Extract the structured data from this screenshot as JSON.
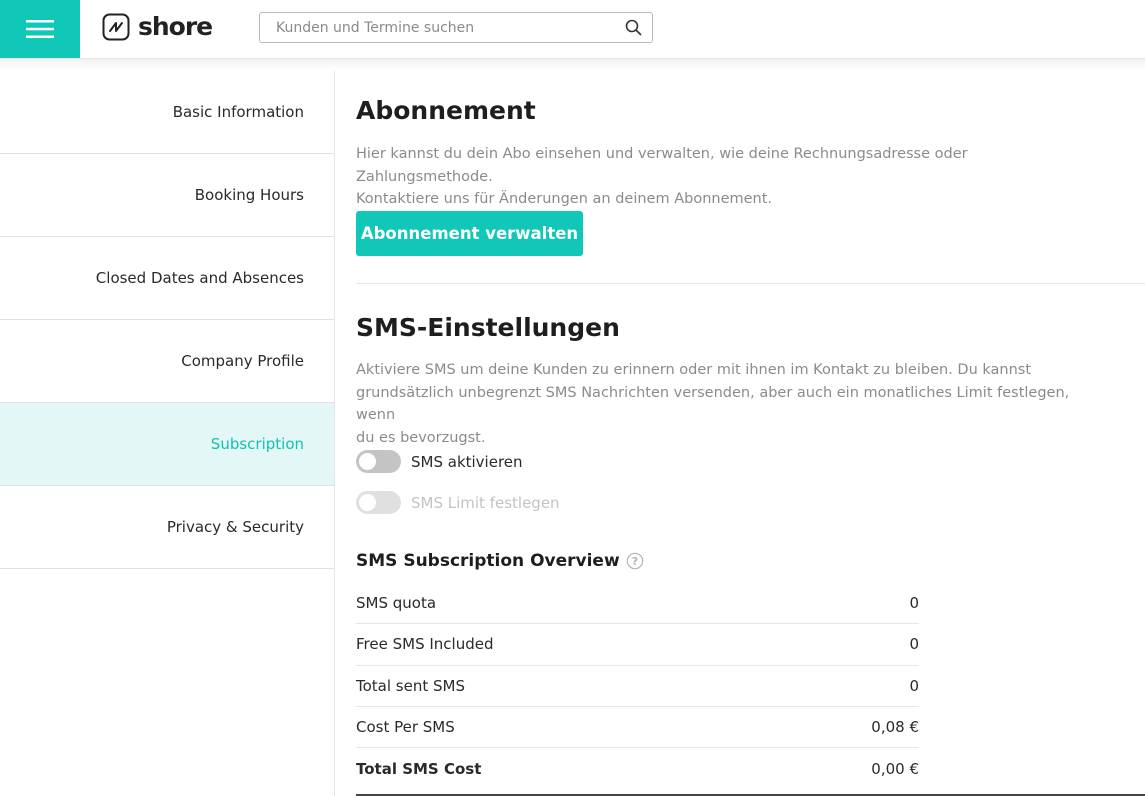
{
  "header": {
    "logo_text": "shore",
    "search_placeholder": "Kunden und Termine suchen"
  },
  "sidebar": {
    "items": [
      {
        "label": "Basic Information"
      },
      {
        "label": "Booking Hours"
      },
      {
        "label": "Closed Dates and Absences"
      },
      {
        "label": "Company Profile"
      },
      {
        "label": "Subscription"
      },
      {
        "label": "Privacy & Security"
      }
    ]
  },
  "subscription": {
    "title": "Abonnement",
    "description_line1": "Hier kannst du dein Abo einsehen und verwalten, wie deine Rechnungsadresse oder Zahlungsmethode.",
    "description_line2": "Kontaktiere uns für Änderungen an deinem Abonnement.",
    "manage_button": "Abonnement verwalten"
  },
  "sms_settings": {
    "title": "SMS-Einstellungen",
    "description_line1": "Aktiviere SMS um deine Kunden zu erinnern oder mit ihnen im Kontakt zu bleiben. Du kannst",
    "description_line2": "grundsätzlich unbegrenzt SMS Nachrichten versenden, aber auch ein monatliches Limit festlegen, wenn",
    "description_line3": "du es bevorzugst.",
    "toggle_activate": "SMS aktivieren",
    "toggle_limit": "SMS Limit festlegen"
  },
  "overview": {
    "title": "SMS Subscription Overview",
    "rows": [
      {
        "label": "SMS quota",
        "value": "0"
      },
      {
        "label": "Free SMS Included",
        "value": "0"
      },
      {
        "label": "Total sent SMS",
        "value": "0"
      },
      {
        "label": "Cost Per SMS",
        "value": "0,08 €"
      },
      {
        "label": "Total SMS Cost",
        "value": "0,00 €"
      }
    ]
  },
  "colors": {
    "accent": "#11c8b8",
    "active_bg": "#e3f8f6"
  }
}
